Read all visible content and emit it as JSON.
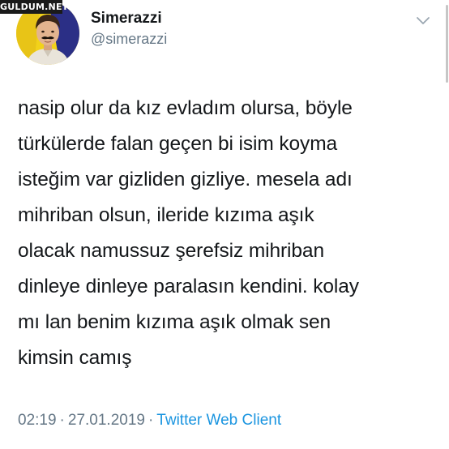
{
  "watermark": {
    "text": "GULDUM.NET"
  },
  "author": {
    "display_name": "Simerazzi",
    "handle": "@simerazzi",
    "avatar_icon": "avatar-photo"
  },
  "tweet": {
    "lines": [
      "nasip olur da kız evladım olursa, böyle",
      "türkülerde falan geçen bi isim koyma",
      "isteğim var gizliden gizliye. mesela adı",
      "mihriban olsun, ileride kızıma aşık",
      "olacak namussuz şerefsiz mihriban",
      "dinleye dinleye paralasın kendini. kolay",
      "mı lan benim kızıma aşık olmak sen",
      "kimsin camış"
    ]
  },
  "meta": {
    "time": "02:19",
    "separator": "·",
    "date": "27.01.2019",
    "client": "Twitter Web Client"
  },
  "colors": {
    "text": "#14171a",
    "secondary": "#657786",
    "link": "#1b95e0",
    "avatar_bg_left": "#f2d21a",
    "avatar_bg_right": "#2b2f86"
  },
  "icons": {
    "menu": "chevron-down-icon"
  }
}
